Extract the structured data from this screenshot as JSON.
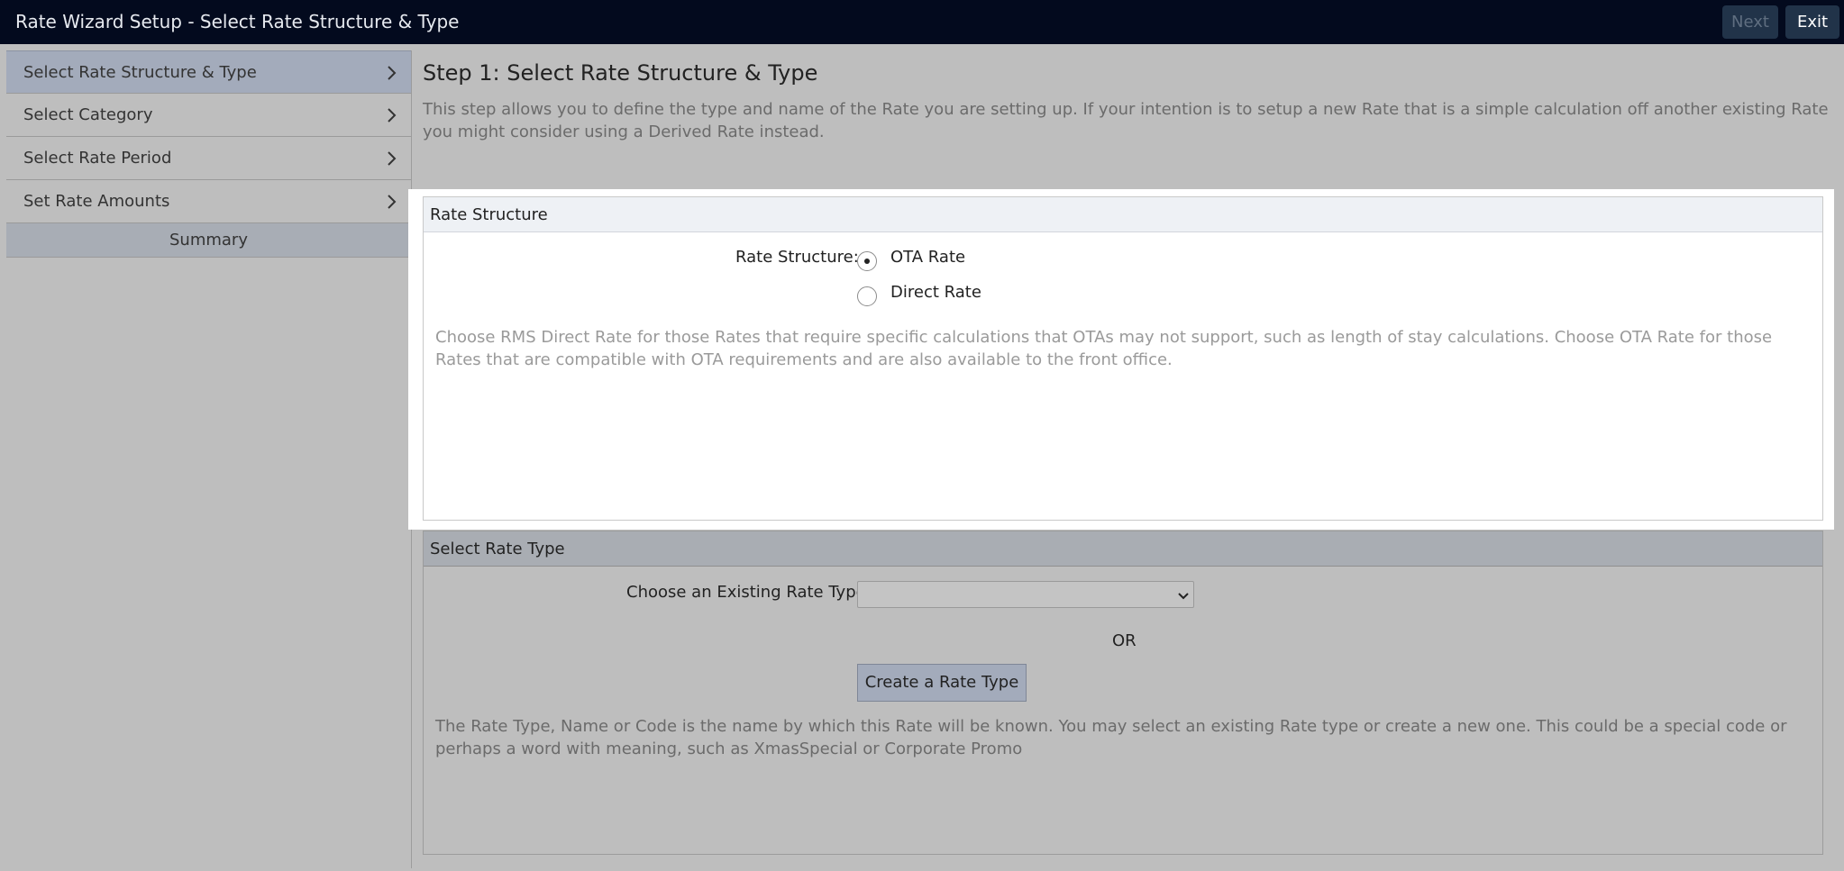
{
  "app": {
    "title": "Rate Wizard Setup - Select Rate Structure & Type",
    "next_label": "Next",
    "exit_label": "Exit"
  },
  "sidebar": {
    "items": [
      {
        "label": "Select Rate Structure & Type",
        "active": true
      },
      {
        "label": "Select Category",
        "active": false
      },
      {
        "label": "Select Rate Period",
        "active": false
      },
      {
        "label": "Set Rate Amounts",
        "active": false
      }
    ],
    "summary_label": "Summary"
  },
  "main": {
    "title": "Step 1: Select Rate Structure & Type",
    "description": "This step allows you to define the type and name of the Rate you are setting up. If your intention is to setup a new Rate that is a simple calculation off another existing Rate you might consider using a Derived Rate instead."
  },
  "rate_structure": {
    "header": "Rate Structure",
    "field_label": "Rate Structure:",
    "options": [
      {
        "label": "OTA Rate",
        "selected": true
      },
      {
        "label": "Direct Rate",
        "selected": false
      }
    ],
    "hint": "Choose RMS Direct Rate for those Rates that require specific calculations that OTAs may not support, such as length of stay calculations. Choose OTA Rate for those Rates that are compatible with OTA requirements and are also available to the front office."
  },
  "rate_type": {
    "header": "Select Rate Type",
    "field_label": "Choose an Existing Rate Type:",
    "selected_value": "",
    "or_label": "OR",
    "create_label": "Create a Rate Type",
    "hint": "The Rate Type, Name or Code is the name by which this Rate will be known. You may select an existing Rate type or create a new one. This could be a special code or perhaps a word with meaning, such as XmasSpecial or Corporate Promo"
  },
  "colors": {
    "topbar": "#030a1e",
    "page_bg": "#bebebe",
    "active_item": "#a3abbb",
    "button": "#a3abbb"
  }
}
